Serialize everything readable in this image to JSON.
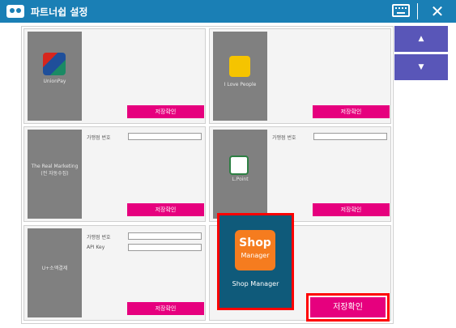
{
  "window": {
    "title": "파트너쉽 설정",
    "close_glyph": "✕"
  },
  "nav": {
    "up": "▲",
    "down": "▼"
  },
  "cards": [
    {
      "caption": "UnionPay",
      "save_label": "저장확인"
    },
    {
      "caption": "I Love People",
      "save_label": "저장확인"
    },
    {
      "caption": "The Real Marketing (전 자동수집)",
      "save_label": "저장확인",
      "field_label": "가맹점 번호",
      "field_value": ""
    },
    {
      "caption": "L.Point",
      "save_label": "저장확인",
      "field_label": "가맹점 번호",
      "field_value": ""
    },
    {
      "caption": "U+소액결제",
      "save_label": "저장확인",
      "field1_label": "가맹점 번호",
      "field1_value": "",
      "field2_label": "API Key",
      "field2_value": ""
    },
    {
      "shop_logo_line1": "Shop",
      "shop_logo_line2": "Manager",
      "shop_caption": "Shop Manager",
      "save_label": "저장확인"
    }
  ],
  "colors": {
    "titlebar": "#1a7fb5",
    "save_button": "#e6007e",
    "nav_button": "#5956b8",
    "shop_tile": "#0f5a7a",
    "highlight": "#ff0000"
  },
  "icons": {
    "title": "handshake-icon",
    "keyboard": "keyboard-icon",
    "close": "close-icon",
    "up": "arrow-up-icon",
    "down": "arrow-down-icon"
  }
}
